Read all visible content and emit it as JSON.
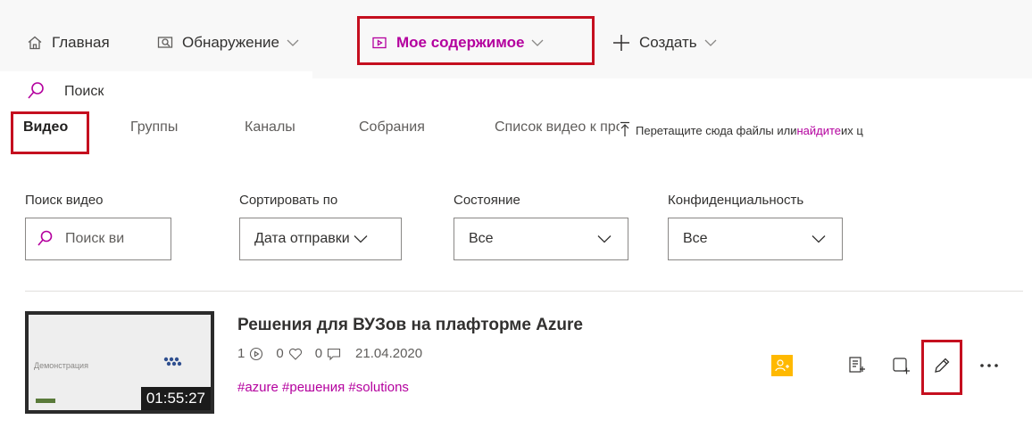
{
  "nav": {
    "items": [
      {
        "label": "Главная",
        "icon": "home-icon"
      },
      {
        "label": "Обнаружение",
        "icon": "discover-icon",
        "has_dropdown": true
      },
      {
        "label": "Мое содержимое",
        "icon": "video-icon",
        "has_dropdown": true,
        "active": true
      },
      {
        "label": "Создать",
        "icon": "plus-icon",
        "has_dropdown": true
      }
    ],
    "accent_color": "#b4009e",
    "highlight_color": "#c50f1f"
  },
  "search": {
    "label": "Поиск",
    "icon": "search-icon"
  },
  "tabs": [
    {
      "label": "Видео",
      "active": true
    },
    {
      "label": "Группы"
    },
    {
      "label": "Каналы"
    },
    {
      "label": "Собрания"
    },
    {
      "label": "Список видео к просмс"
    }
  ],
  "upload": {
    "text_before": "Перетащите сюда файлы или ",
    "link": "найдите",
    "text_after": " их ц",
    "icon": "upload-icon"
  },
  "filters": {
    "search": {
      "label": "Поиск видео",
      "placeholder": "Поиск ви"
    },
    "sort": {
      "label": "Сортировать по",
      "value": "Дата отправки"
    },
    "state": {
      "label": "Состояние",
      "value": "Все"
    },
    "privacy": {
      "label": "Конфиденциальность",
      "value": "Все"
    }
  },
  "video": {
    "title": "Решения для ВУЗов на плафторме Azure",
    "views": "1",
    "likes": "0",
    "comments": "0",
    "date": "21.04.2020",
    "tags": "#azure #решения #solutions",
    "duration": "01:55:27",
    "thumb_caption": "Демонстрация",
    "badge_color": "#ffb900",
    "actions": [
      "transcript-icon",
      "add-to-list-icon",
      "edit-icon",
      "more-icon"
    ]
  }
}
